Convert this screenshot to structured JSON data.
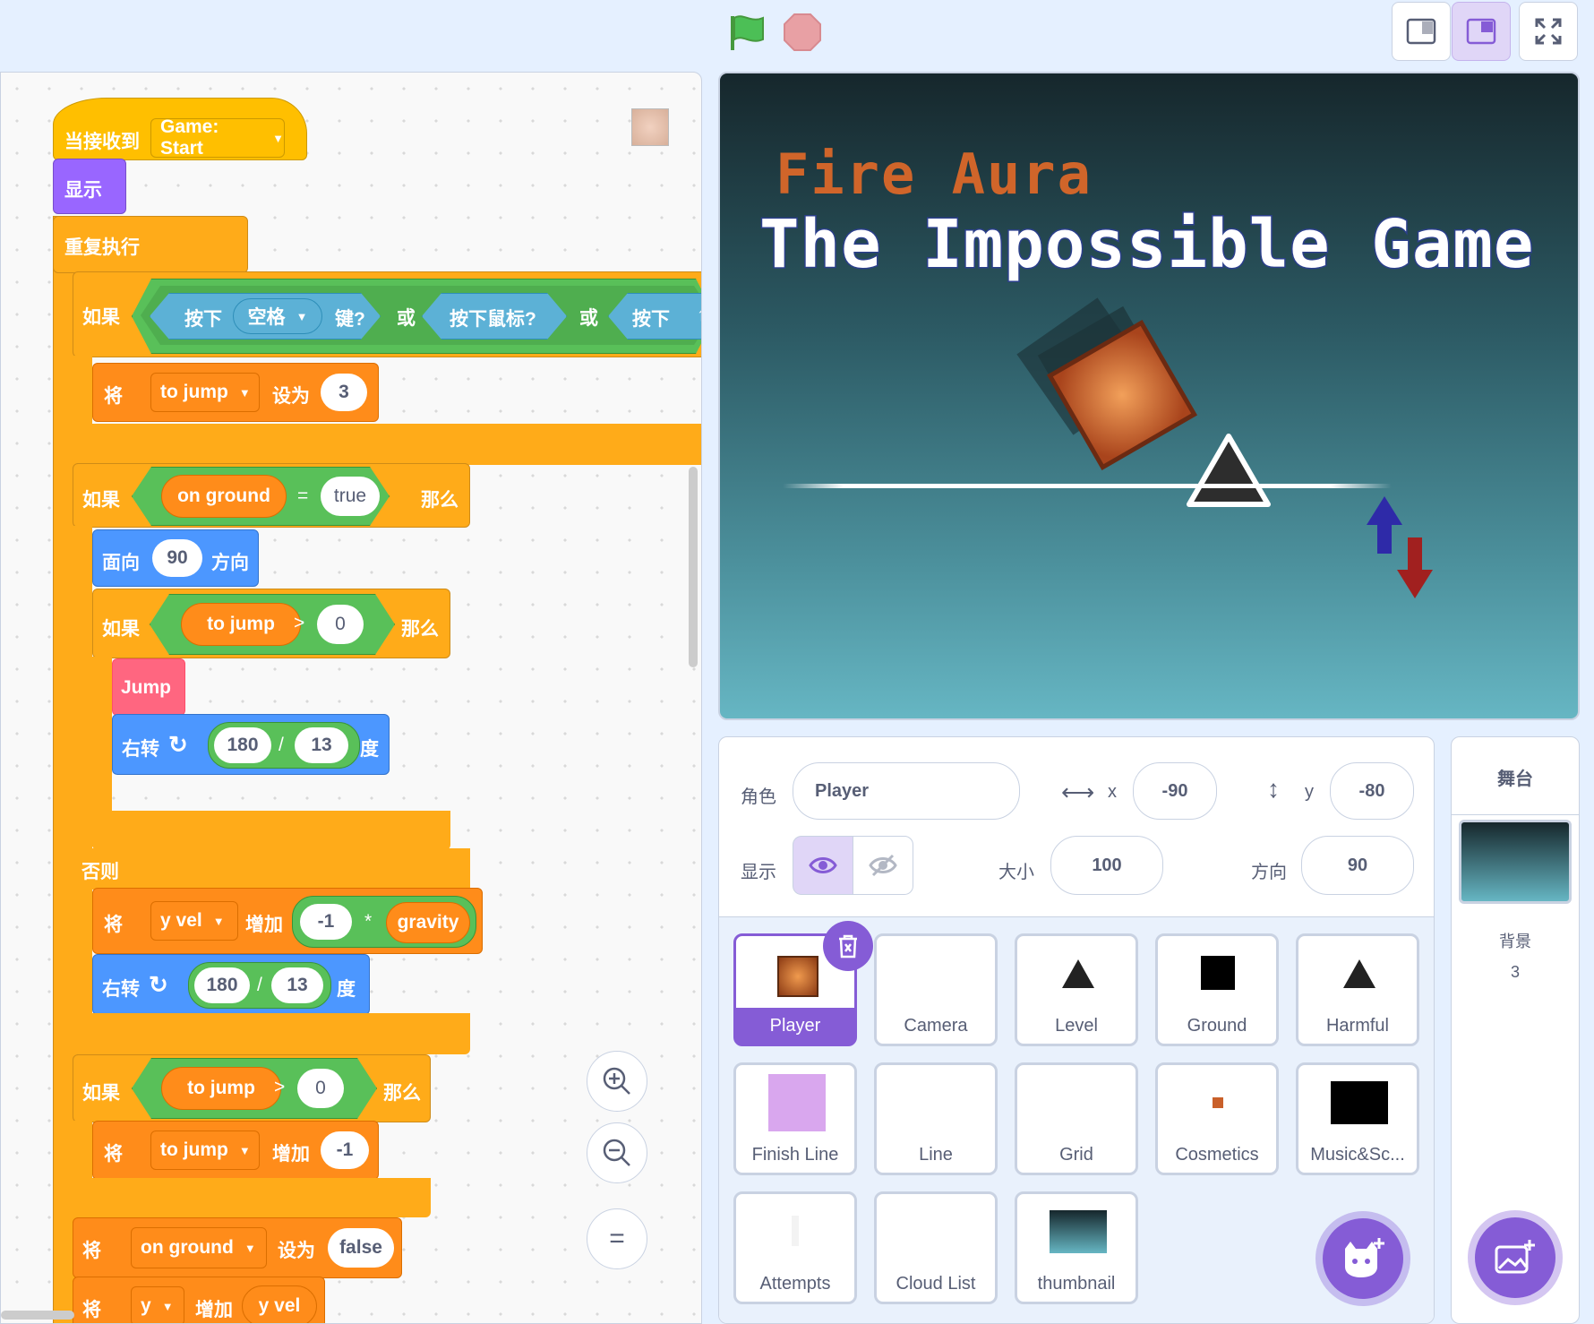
{
  "topbar": {
    "green_flag_icon": "green-flag-icon",
    "stop_icon": "stop-icon",
    "modes": [
      "small-stage-icon",
      "normal-stage-icon",
      "fullscreen-icon"
    ]
  },
  "code": {
    "event_hat": {
      "label": "当接收到",
      "message": "Game: Start"
    },
    "show": "显示",
    "forever": "重复执行",
    "if1": {
      "label": "如果",
      "key_pressed": "按下",
      "key": "空格",
      "key_suffix": "键?",
      "or": "或",
      "mouse_down": "按下鼠标?",
      "or2": "或",
      "key_pressed2": "按下",
      "cut": "↑"
    },
    "set_jump": {
      "label": "将",
      "var": "to jump",
      "to": "设为",
      "value": "3"
    },
    "if2": {
      "label": "如果",
      "left": "on ground",
      "eq": "=",
      "right": "true",
      "then": "那么"
    },
    "point_dir": {
      "label": "面向",
      "value": "90",
      "suffix": "方向"
    },
    "if3": {
      "label": "如果",
      "left": "to jump",
      "gt": ">",
      "right": "0",
      "then": "那么"
    },
    "jump_call": "Jump",
    "turn1": {
      "label": "右转",
      "a": "180",
      "div": "/",
      "b": "13",
      "suffix": "度"
    },
    "else": "否则",
    "change_yvel": {
      "label": "将",
      "var": "y vel",
      "by": "增加",
      "a": "-1",
      "mul": "*",
      "b": "gravity"
    },
    "turn2": {
      "label": "右转",
      "a": "180",
      "div": "/",
      "b": "13",
      "suffix": "度"
    },
    "if4": {
      "label": "如果",
      "left": "to jump",
      "gt": ">",
      "right": "0",
      "then": "那么"
    },
    "change_jump": {
      "label": "将",
      "var": "to jump",
      "by": "增加",
      "value": "-1"
    },
    "set_ground": {
      "label": "将",
      "var": "on ground",
      "to": "设为",
      "value": "false"
    },
    "change_y": {
      "label": "将",
      "var": "y",
      "by": "增加",
      "value": "y vel"
    },
    "zoom": {
      "in": "+",
      "out": "−",
      "reset": "="
    }
  },
  "stage": {
    "subtitle": "Fire Aura",
    "title": "The Impossible Game"
  },
  "sprite_info": {
    "sprite_label": "角色",
    "sprite_name": "Player",
    "x_label": "x",
    "x": "-90",
    "y_label": "y",
    "y": "-80",
    "show_label": "显示",
    "size_label": "大小",
    "size": "100",
    "direction_label": "方向",
    "direction": "90"
  },
  "sprites": [
    {
      "name": "Player"
    },
    {
      "name": "Camera"
    },
    {
      "name": "Level"
    },
    {
      "name": "Ground"
    },
    {
      "name": "Harmful"
    },
    {
      "name": "Finish Line"
    },
    {
      "name": "Line"
    },
    {
      "name": "Grid"
    },
    {
      "name": "Cosmetics"
    },
    {
      "name": "Music&Sc..."
    },
    {
      "name": "Attempts"
    },
    {
      "name": "Cloud List"
    },
    {
      "name": "thumbnail"
    }
  ],
  "stage_panel": {
    "title": "舞台",
    "backdrops_label": "背景",
    "backdrops_count": "3"
  },
  "colors": {
    "accent": "#855cd6",
    "control": "#ffab19",
    "variables": "#ff8c1a",
    "operators": "#59c059",
    "motion": "#4c97ff",
    "looks": "#9966ff",
    "sensing": "#5cb1d6",
    "myblocks": "#ff6680",
    "events": "#ffbf00"
  }
}
